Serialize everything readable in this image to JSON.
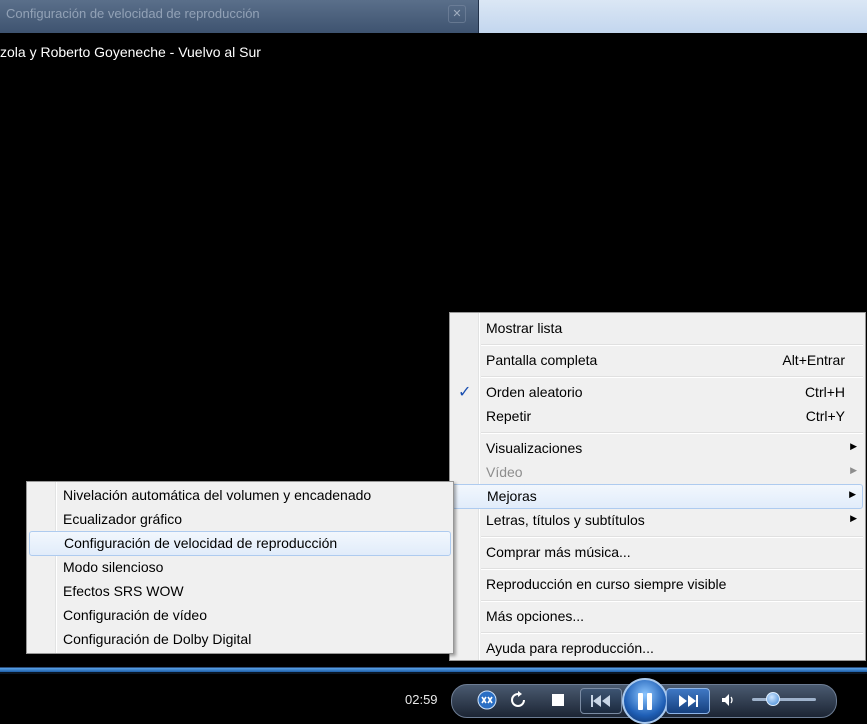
{
  "background_dialog": {
    "title": "Configuración de velocidad de reproducción",
    "close": "✕"
  },
  "now_playing": "zola y Roberto Goyeneche - Vuelvo al Sur",
  "context_menu": {
    "items": [
      {
        "label": "Mostrar lista"
      },
      {
        "label": "Pantalla completa",
        "shortcut": "Alt+Entrar"
      },
      {
        "label": "Orden aleatorio",
        "shortcut": "Ctrl+H",
        "checked": "✓"
      },
      {
        "label": "Repetir",
        "shortcut": "Ctrl+Y"
      },
      {
        "label": "Visualizaciones",
        "arrow": "▶"
      },
      {
        "label": "Vídeo",
        "arrow": "▶"
      },
      {
        "label": "Mejoras",
        "arrow": "▶"
      },
      {
        "label": "Letras, títulos y subtítulos",
        "arrow": "▶"
      },
      {
        "label": "Comprar más música..."
      },
      {
        "label": "Reproducción en curso siempre visible"
      },
      {
        "label": "Más opciones..."
      },
      {
        "label": "Ayuda para reproducción..."
      }
    ]
  },
  "submenu_mejoras": {
    "items": [
      {
        "label": "Nivelación automática del volumen y encadenado"
      },
      {
        "label": "Ecualizador gráfico"
      },
      {
        "label": "Configuración de velocidad de reproducción"
      },
      {
        "label": "Modo silencioso"
      },
      {
        "label": "Efectos SRS WOW"
      },
      {
        "label": "Configuración de vídeo"
      },
      {
        "label": "Configuración de Dolby Digital"
      }
    ]
  },
  "controls": {
    "time": "02:59",
    "icons": {
      "shuffle": "shuffle-icon",
      "repeat": "repeat-icon",
      "stop": "stop-icon",
      "previous": "previous-icon",
      "pause": "pause-icon",
      "next": "next-icon",
      "volume": "volume-icon"
    },
    "volume_level": 0.3
  },
  "colors": {
    "accent": "#1f5fb6",
    "menu_bg": "#f0f0f0",
    "highlight_border": "#aecbef"
  }
}
